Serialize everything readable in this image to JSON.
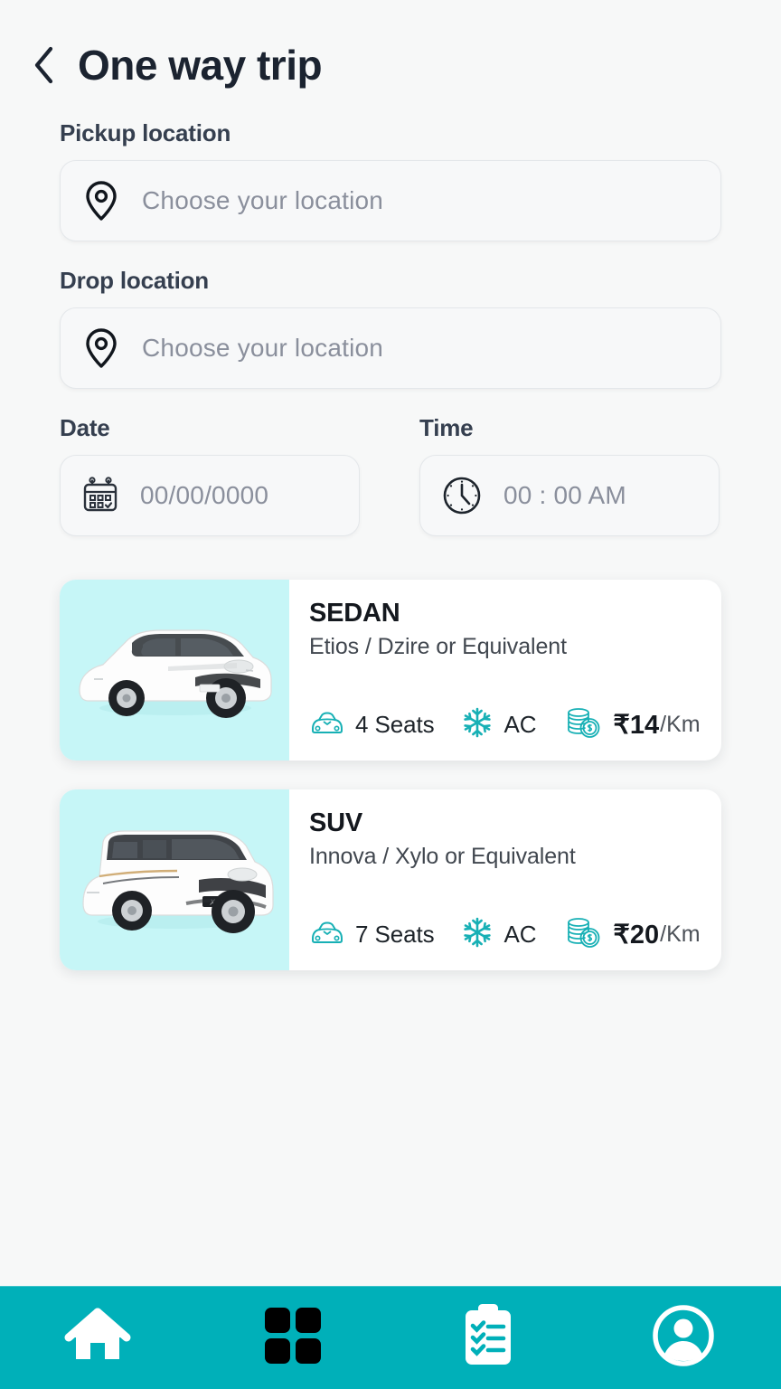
{
  "header": {
    "back_icon": "chevron-left-icon",
    "title": "One way trip"
  },
  "form": {
    "pickup": {
      "label": "Pickup location",
      "icon": "location-pin-icon",
      "placeholder": "Choose your location",
      "value": "Choose your location"
    },
    "drop": {
      "label": "Drop location",
      "icon": "location-pin-icon",
      "placeholder": "Choose your location",
      "value": "Choose your location"
    },
    "date": {
      "label": "Date",
      "icon": "calendar-icon",
      "placeholder": "00/00/0000",
      "value": "00/00/0000"
    },
    "time": {
      "label": "Time",
      "icon": "clock-icon",
      "placeholder": "00 : 00 AM",
      "value": "00 : 00 AM"
    }
  },
  "vehicles": [
    {
      "name": "SEDAN",
      "subtitle": "Etios / Dzire or Equivalent",
      "image": "white-sedan-car-photo",
      "seats_icon": "car-front-icon",
      "seats": "4 Seats",
      "ac_icon": "snowflake-icon",
      "ac": "AC",
      "price_icon": "coins-stack-icon",
      "price": "₹14",
      "price_unit": "/Km"
    },
    {
      "name": "SUV",
      "subtitle": "Innova / Xylo or Equivalent",
      "image": "white-suv-car-photo",
      "seats_icon": "car-front-icon",
      "seats": "7 Seats",
      "ac_icon": "snowflake-icon",
      "ac": "AC",
      "price_icon": "coins-stack-icon",
      "price": "₹20",
      "price_unit": "/Km"
    }
  ],
  "bottom_nav": {
    "items": [
      {
        "icon": "home-icon",
        "label": "Home",
        "active": false
      },
      {
        "icon": "grid-dashboard-icon",
        "label": "Dashboard",
        "active": true
      },
      {
        "icon": "clipboard-checklist-icon",
        "label": "Bookings",
        "active": false
      },
      {
        "icon": "user-profile-icon",
        "label": "Profile",
        "active": false
      }
    ]
  },
  "colors": {
    "page_background": "#f7f8f8",
    "title_text": "#1b2330",
    "label_text": "#353f4f",
    "placeholder_text": "#8a8f9c",
    "card_image_background": "#c6f6f7",
    "accent_teal": "#00b0b9",
    "spec_icon_teal": "#17b0b5",
    "nav_active_icon": "#000000",
    "nav_inactive_icon": "#ffffff"
  }
}
